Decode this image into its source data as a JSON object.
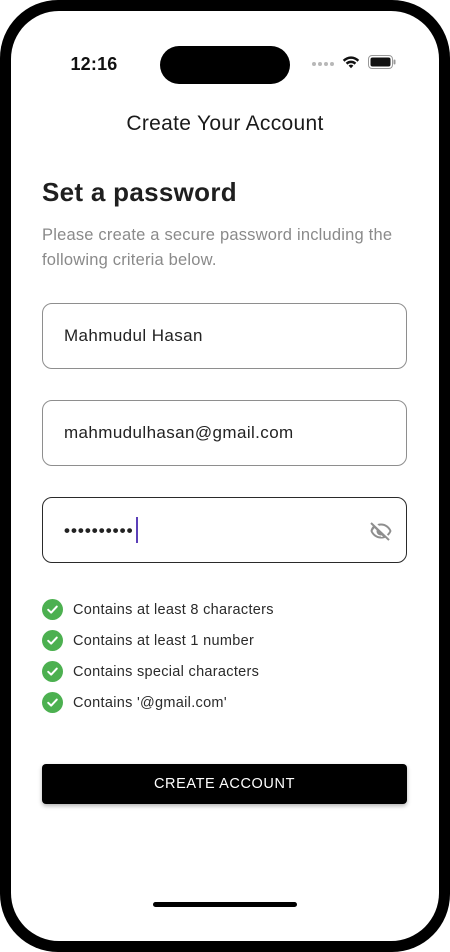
{
  "status_bar": {
    "time": "12:16",
    "icons": [
      "signal-icon",
      "wifi-icon",
      "battery-icon"
    ]
  },
  "nav": {
    "title": "Create Your Account"
  },
  "form": {
    "heading": "Set a password",
    "subtitle": "Please create a secure password including the following criteria below.",
    "name_value": "Mahmudul Hasan",
    "email_value": "mahmudulhasan@gmail.com",
    "password_masked": "••••••••••",
    "password_visibility_icon": "eye-off-icon"
  },
  "criteria": [
    {
      "label": "Contains at least 8 characters",
      "met": true
    },
    {
      "label": "Contains at least 1 number",
      "met": true
    },
    {
      "label": "Contains special characters",
      "met": true
    },
    {
      "label": "Contains '@gmail.com'",
      "met": true
    }
  ],
  "actions": {
    "create_account_label": "CREATE ACCOUNT"
  },
  "colors": {
    "accent": "#000000",
    "check": "#4cb050",
    "caret": "#5b3fb8",
    "muted_text": "#8a8a8a"
  }
}
